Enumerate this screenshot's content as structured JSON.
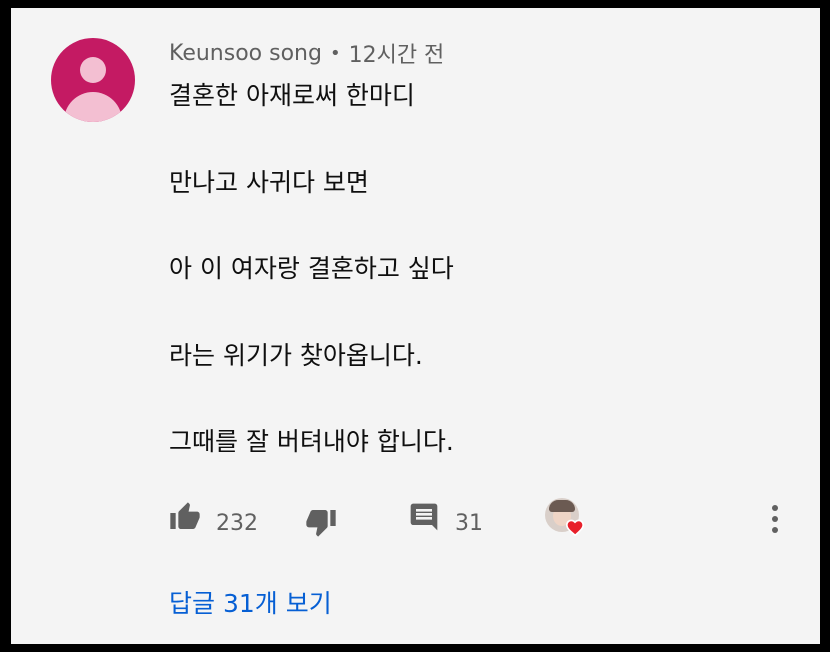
{
  "comment": {
    "author": "Keunsoo song",
    "separator": "•",
    "time": "12시간 전",
    "lines": [
      "결혼한 아재로써 한마디",
      "만나고 사귀다 보면",
      "아 이 여자랑 결혼하고 싶다",
      "라는 위기가 찾아옵니다.",
      "그때를 잘 버텨내야 합니다."
    ]
  },
  "actions": {
    "like_icon": "thumbs-up-icon",
    "like_count": "232",
    "dislike_icon": "thumbs-down-icon",
    "reply_icon": "comment-icon",
    "reply_count": "31",
    "creator_heart_icon": "heart-icon",
    "more_icon": "more-vertical-icon"
  },
  "replies": {
    "label": "답글 31개 보기"
  },
  "colors": {
    "background": "#f4f4f4",
    "avatar": "#c41a63",
    "avatar_figure": "#f3bfd2",
    "meta_text": "#606060",
    "body_text": "#0f0f0f",
    "link": "#065fd4",
    "heart": "#e8202b"
  }
}
